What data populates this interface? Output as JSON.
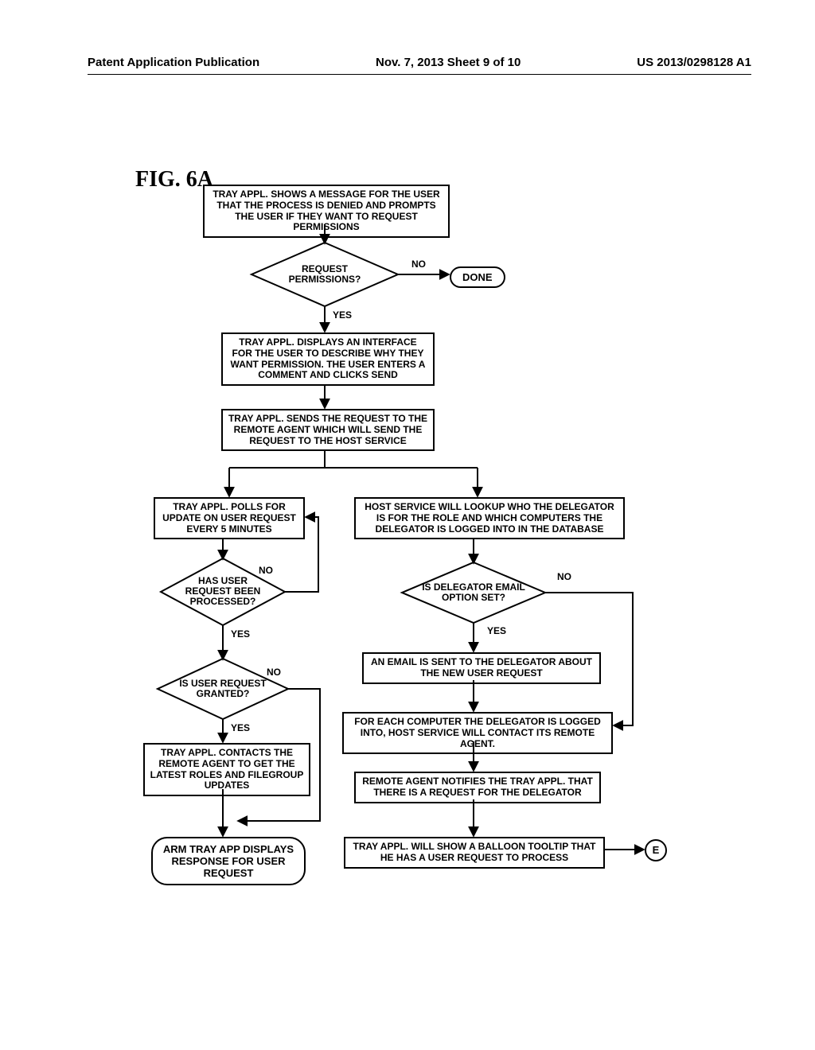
{
  "header": {
    "left": "Patent Application Publication",
    "center": "Nov. 7, 2013  Sheet 9 of 10",
    "right": "US 2013/0298128 A1"
  },
  "figure_label": "FIG. 6A",
  "boxes": {
    "b_start": "TRAY APPL. SHOWS A MESSAGE FOR THE USER THAT THE PROCESS IS DENIED AND PROMPTS THE USER IF THEY WANT TO REQUEST PERMISSIONS",
    "b_interface": "TRAY APPL. DISPLAYS AN INTERFACE FOR THE USER TO DESCRIBE WHY THEY WANT PERMISSION. THE USER ENTERS A COMMENT AND CLICKS SEND",
    "b_send": "TRAY APPL. SENDS THE REQUEST TO THE REMOTE AGENT WHICH WILL SEND THE REQUEST TO THE HOST SERVICE",
    "b_poll": "TRAY APPL. POLLS FOR UPDATE ON USER REQUEST EVERY 5 MINUTES",
    "b_lookup": "HOST SERVICE WILL LOOKUP WHO THE DELEGATOR IS FOR THE ROLE AND WHICH COMPUTERS THE DELEGATOR IS LOGGED INTO IN THE DATABASE",
    "b_email": "AN EMAIL IS SENT TO THE DELEGATOR ABOUT THE NEW USER REQUEST",
    "b_foreach": "FOR EACH COMPUTER THE DELEGATOR IS LOGGED INTO, HOST SERVICE WILL CONTACT ITS REMOTE AGENT.",
    "b_notify": "REMOTE AGENT NOTIFIES THE TRAY APPL. THAT THERE IS A REQUEST FOR THE DELEGATOR",
    "b_balloon": "TRAY APPL. WILL SHOW A BALLOON TOOLTIP THAT HE HAS A USER REQUEST TO PROCESS",
    "b_contacts": "TRAY APPL. CONTACTS THE REMOTE AGENT TO GET THE LATEST ROLES AND FILEGROUP UPDATES",
    "b_display": "ARM TRAY APP DISPLAYS RESPONSE FOR USER REQUEST"
  },
  "diamonds": {
    "d_perm": "REQUEST PERMISSIONS?",
    "d_processed": "HAS USER REQUEST BEEN PROCESSED?",
    "d_granted": "IS USER REQUEST GRANTED?",
    "d_emailopt": "IS DELEGATOR EMAIL OPTION SET?"
  },
  "terminals": {
    "t_done": "DONE"
  },
  "labels": {
    "yes": "YES",
    "no": "NO"
  },
  "connectors": {
    "c_e": "E"
  }
}
